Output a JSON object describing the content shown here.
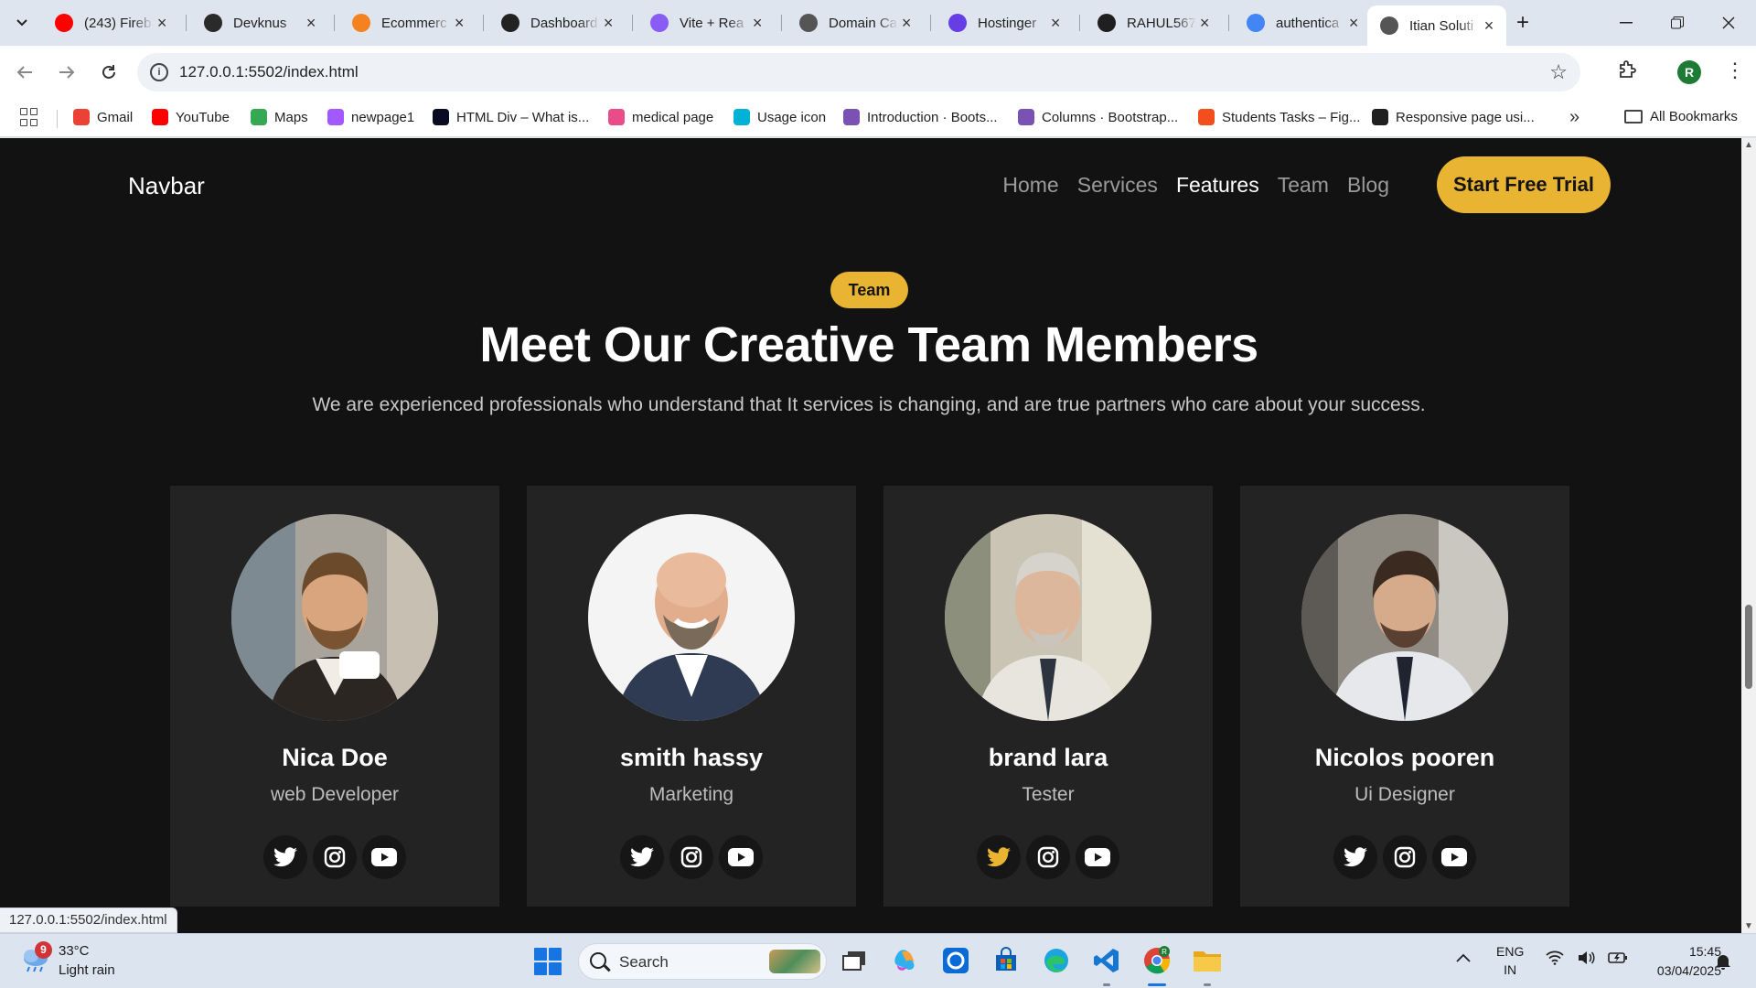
{
  "browser": {
    "tabs": [
      {
        "title": "(243) Fireb",
        "icon": "youtube-icon",
        "color": "#ff0000"
      },
      {
        "title": "Devknus",
        "icon": "devknus-icon",
        "color": "#2a2a2a"
      },
      {
        "title": "Ecommerc",
        "icon": "firebase-icon",
        "color": "#f58220"
      },
      {
        "title": "Dashboard",
        "icon": "openai-icon",
        "color": "#222222"
      },
      {
        "title": "Vite + Rea",
        "icon": "vite-icon",
        "color": "#8a5cf6"
      },
      {
        "title": "Domain Ca",
        "icon": "globe-icon",
        "color": "#555555"
      },
      {
        "title": "Hostinger",
        "icon": "hostinger-icon",
        "color": "#673de6"
      },
      {
        "title": "RAHUL567",
        "icon": "github-icon",
        "color": "#1f1f1f"
      },
      {
        "title": "authentica",
        "icon": "google-icon",
        "color": "#4285f4"
      },
      {
        "title": "Itian Soluti",
        "icon": "globe-icon",
        "color": "#555555"
      }
    ],
    "url": "127.0.0.1:5502/index.html",
    "profile_initial": "R",
    "bookmarks": [
      {
        "label": "Gmail",
        "color": "#ea4335"
      },
      {
        "label": "YouTube",
        "color": "#ff0000"
      },
      {
        "label": "Maps",
        "color": "#34a853"
      },
      {
        "label": "newpage1",
        "color": "#a259ff"
      },
      {
        "label": "HTML Div – What is...",
        "color": "#0a0a23"
      },
      {
        "label": "medical page",
        "color": "#ea4c89"
      },
      {
        "label": "Usage icon",
        "color": "#00b3d6"
      },
      {
        "label": "Introduction · Boots...",
        "color": "#7952b3"
      },
      {
        "label": "Columns · Bootstrap...",
        "color": "#7952b3"
      },
      {
        "label": "Students Tasks – Fig...",
        "color": "#f24e1e"
      },
      {
        "label": "Responsive page usi...",
        "color": "#1f1f1f"
      }
    ],
    "all_bookmarks": "All Bookmarks",
    "status_url": "127.0.0.1:5502/index.html"
  },
  "site": {
    "brand": "Navbar",
    "nav": [
      {
        "label": "Home",
        "active": false
      },
      {
        "label": "Services",
        "active": false
      },
      {
        "label": "Features",
        "active": true
      },
      {
        "label": "Team",
        "active": false
      },
      {
        "label": "Blog",
        "active": false
      }
    ],
    "cta": "Start Free Trial",
    "accent": "#e9b431",
    "section_pill": "Team",
    "heading": "Meet Our Creative Team Members",
    "subheading": "We are experienced professionals who understand that It services is changing, and are true partners who care about your success.",
    "members": [
      {
        "name": "Nica Doe",
        "role": "web Developer",
        "twitter_highlight": false
      },
      {
        "name": "smith hassy",
        "role": "Marketing",
        "twitter_highlight": false
      },
      {
        "name": "brand lara",
        "role": "Tester",
        "twitter_highlight": true
      },
      {
        "name": "Nicolos pooren",
        "role": "Ui Designer",
        "twitter_highlight": false
      }
    ]
  },
  "taskbar": {
    "weather_badge": "9",
    "temperature": "33°C",
    "weather": "Light rain",
    "search_label": "Search",
    "lang_line1": "ENG",
    "lang_line2": "IN",
    "time": "15:45",
    "date": "03/04/2025"
  }
}
